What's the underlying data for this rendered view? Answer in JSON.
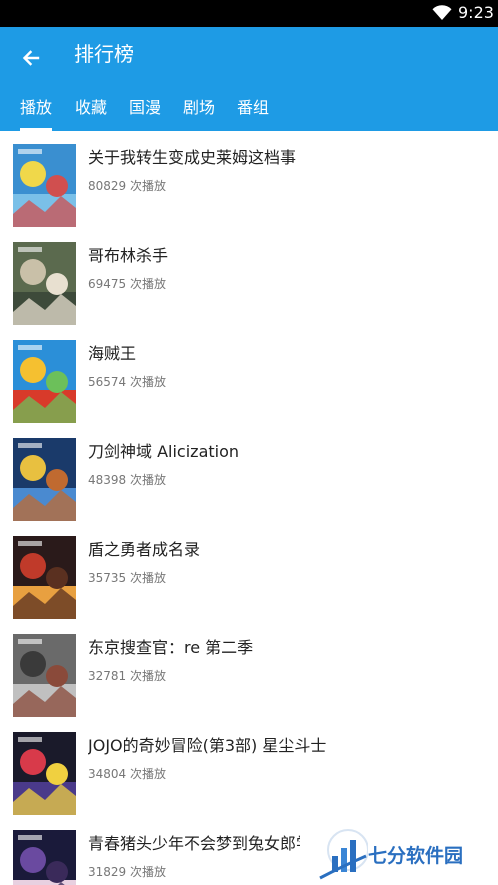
{
  "status_bar": {
    "time": "9:23",
    "icon": "wifi-icon"
  },
  "app_bar": {
    "title": "排行榜",
    "back_icon": "back-arrow-icon",
    "color": "#1e9be5"
  },
  "tabs": [
    {
      "label": "播放",
      "active": true
    },
    {
      "label": "收藏",
      "active": false
    },
    {
      "label": "国漫",
      "active": false
    },
    {
      "label": "剧场",
      "active": false
    },
    {
      "label": "番组",
      "active": false
    }
  ],
  "items": [
    {
      "title": "关于我转生变成史莱姆这档事",
      "plays": "80829 次播放",
      "colors": [
        "#3a8fd0",
        "#f0d84a",
        "#7ac0e8",
        "#d04f4f"
      ]
    },
    {
      "title": "哥布林杀手",
      "plays": "69475 次播放",
      "colors": [
        "#5b6a4e",
        "#c9c0a8",
        "#3d4a3a",
        "#e8e0d0"
      ]
    },
    {
      "title": "海贼王",
      "plays": "56574 次播放",
      "colors": [
        "#2b8fd8",
        "#f5c030",
        "#d83a2a",
        "#6cc05a"
      ]
    },
    {
      "title": "刀剑神域 Alicization",
      "plays": "48398 次播放",
      "colors": [
        "#1a3a6a",
        "#e8c040",
        "#4a8ad0",
        "#c06a30"
      ]
    },
    {
      "title": "盾之勇者成名录",
      "plays": "35735 次播放",
      "colors": [
        "#2a1a1a",
        "#c03a2a",
        "#e8a040",
        "#5a3020"
      ]
    },
    {
      "title": "东京搜查官：re 第二季",
      "plays": "32781 次播放",
      "colors": [
        "#6a6a6a",
        "#3a3a3a",
        "#c0c0c0",
        "#8a4a3a"
      ]
    },
    {
      "title": "JOJO的奇妙冒险(第3部) 星尘斗士",
      "plays": "34804 次播放",
      "colors": [
        "#1a1a2a",
        "#d83a4a",
        "#4a3a8a",
        "#f0d040"
      ]
    },
    {
      "title": "青春猪头少年不会梦到兔女郎学姐",
      "plays": "31829 次播放",
      "colors": [
        "#1a1a3a",
        "#6a4aa0",
        "#e8d0e0",
        "#3a2a5a"
      ]
    }
  ],
  "watermark": {
    "text": "七分软件园"
  }
}
